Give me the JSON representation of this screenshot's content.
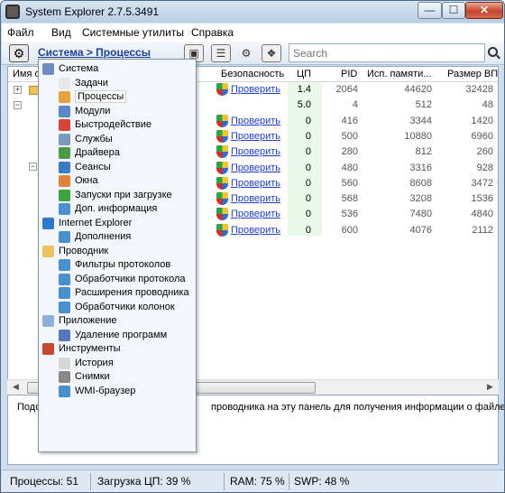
{
  "window": {
    "title": "System Explorer 2.7.5.3491",
    "controls": {
      "min": "—",
      "max": "☐",
      "close": "✕"
    }
  },
  "menu": [
    "Файл",
    "Вид",
    "Системные утилиты",
    "Справка"
  ],
  "toolbar": {
    "breadcrumb": "Система > Процессы",
    "search_placeholder": "Search"
  },
  "table": {
    "headers": {
      "name": "Имя о",
      "security": "Безопасность",
      "cpu": "ЦП",
      "pid": "PID",
      "mem": "Исп. памяти...",
      "vm": "Размер ВП"
    },
    "rows": [
      {
        "security": "Проверить",
        "cpu": "1.4",
        "pid": "2064",
        "mem": "44620",
        "vm": "32428"
      },
      {
        "security": "",
        "cpu": "5.0",
        "pid": "4",
        "mem": "512",
        "vm": "48"
      },
      {
        "security": "Проверить",
        "cpu": "0",
        "pid": "416",
        "mem": "3344",
        "vm": "1420"
      },
      {
        "security": "Проверить",
        "cpu": "0",
        "pid": "500",
        "mem": "10880",
        "vm": "6960"
      },
      {
        "security": "Проверить",
        "cpu": "0",
        "pid": "280",
        "mem": "812",
        "vm": "260"
      },
      {
        "security": "Проверить",
        "cpu": "0",
        "pid": "480",
        "mem": "3316",
        "vm": "928"
      },
      {
        "security": "Проверить",
        "cpu": "0",
        "pid": "560",
        "mem": "8608",
        "vm": "3472"
      },
      {
        "security": "Проверить",
        "cpu": "0",
        "pid": "568",
        "mem": "3208",
        "vm": "1536"
      },
      {
        "security": "Проверить",
        "cpu": "0",
        "pid": "536",
        "mem": "7480",
        "vm": "4840"
      },
      {
        "security": "Проверить",
        "cpu": "0",
        "pid": "600",
        "mem": "4076",
        "vm": "2112"
      }
    ]
  },
  "info_panel": {
    "text_left": "Подо",
    "text_right": "проводника на эту панель для получения информации о файле"
  },
  "status": {
    "processes": "Процессы: 51",
    "cpu": "Загрузка ЦП: 39 %",
    "ram": "RAM: 75 %",
    "swp": "SWP: 48 %"
  },
  "dropdown": {
    "items": [
      {
        "label": "Система",
        "icon": "computer-icon",
        "color": "#6c8fbf",
        "level": 0,
        "active": false
      },
      {
        "label": "Задачи",
        "icon": "tasks-icon",
        "color": "#e8e8e8",
        "level": 1,
        "active": false
      },
      {
        "label": "Процессы",
        "icon": "processes-gear-icon",
        "color": "#e9a23b",
        "level": 1,
        "active": true
      },
      {
        "label": "Модули",
        "icon": "modules-icon",
        "color": "#5b87c9",
        "level": 1,
        "active": false
      },
      {
        "label": "Быстродействие",
        "icon": "performance-icon",
        "color": "#d9433a",
        "level": 1,
        "active": false
      },
      {
        "label": "Службы",
        "icon": "services-icon",
        "color": "#7a9ab8",
        "level": 1,
        "active": false
      },
      {
        "label": "Драйвера",
        "icon": "drivers-icon",
        "color": "#4a9a4a",
        "level": 1,
        "active": false
      },
      {
        "label": "Сеансы",
        "icon": "sessions-icon",
        "color": "#3a7bc4",
        "level": 1,
        "active": false
      },
      {
        "label": "Окна",
        "icon": "windows-logo-icon",
        "color": "#e0823a",
        "level": 1,
        "active": false
      },
      {
        "label": "Запуски при загрузке",
        "icon": "startup-arrow-icon",
        "color": "#3da33d",
        "level": 1,
        "active": false
      },
      {
        "label": "Доп. информация",
        "icon": "info-puzzle-icon",
        "color": "#4a8fd0",
        "level": 1,
        "active": false
      },
      {
        "label": "Internet Explorer",
        "icon": "internet-explorer-icon",
        "color": "#2d78d1",
        "level": 0,
        "active": false
      },
      {
        "label": "Дополнения",
        "icon": "addons-puzzle-icon",
        "color": "#4a8fd0",
        "level": 1,
        "active": false
      },
      {
        "label": "Проводник",
        "icon": "folder-icon",
        "color": "#e9c35b",
        "level": 0,
        "active": false
      },
      {
        "label": "Фильтры протоколов",
        "icon": "protocol-filters-icon",
        "color": "#4a8fd0",
        "level": 1,
        "active": false
      },
      {
        "label": "Обработчики протокола",
        "icon": "protocol-handlers-icon",
        "color": "#4a8fd0",
        "level": 1,
        "active": false
      },
      {
        "label": "Расширения проводника",
        "icon": "explorer-extensions-icon",
        "color": "#4a8fd0",
        "level": 1,
        "active": false
      },
      {
        "label": "Обработчики колонок",
        "icon": "column-handlers-icon",
        "color": "#4a8fd0",
        "level": 1,
        "active": false
      },
      {
        "label": "Приложение",
        "icon": "application-icon",
        "color": "#8fb0d8",
        "level": 0,
        "active": false
      },
      {
        "label": "Удаление программ",
        "icon": "uninstall-icon",
        "color": "#5577bb",
        "level": 1,
        "active": false
      },
      {
        "label": "Инструменты",
        "icon": "toolbox-icon",
        "color": "#c8452f",
        "level": 0,
        "active": false
      },
      {
        "label": "История",
        "icon": "history-clock-icon",
        "color": "#d8d8d8",
        "level": 1,
        "active": false
      },
      {
        "label": "Снимки",
        "icon": "camera-icon",
        "color": "#888888",
        "level": 1,
        "active": false
      },
      {
        "label": "WMI-браузер",
        "icon": "wmi-puzzle-icon",
        "color": "#4a8fd0",
        "level": 1,
        "active": false
      }
    ]
  }
}
